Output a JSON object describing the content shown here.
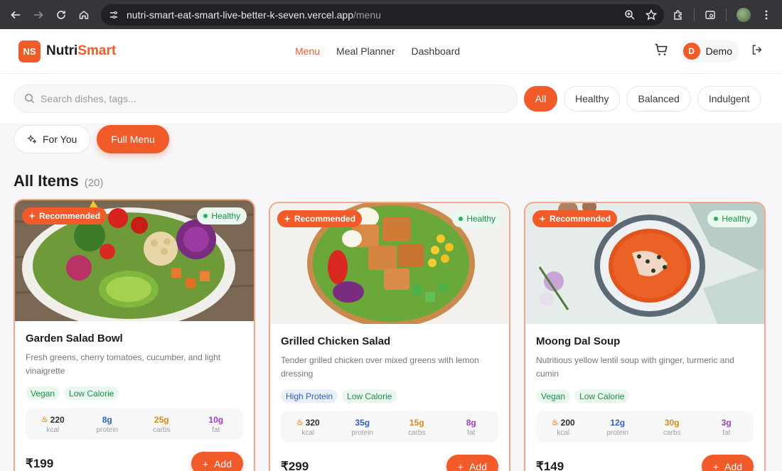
{
  "browser": {
    "url_host": "nutri-smart-eat-smart-live-better-k-seven.vercel.app",
    "url_path": "/menu"
  },
  "brand": {
    "badge": "NS",
    "name_part1": "Nutri",
    "name_part2": "Smart",
    "accent": "#f15a29"
  },
  "nav": {
    "items": [
      "Menu",
      "Meal Planner",
      "Dashboard"
    ],
    "active": "Menu"
  },
  "user": {
    "initial": "D",
    "name": "Demo"
  },
  "search": {
    "placeholder": "Search dishes, tags..."
  },
  "filters": [
    "All",
    "Healthy",
    "Balanced",
    "Indulgent"
  ],
  "modes": {
    "for_you": "For You",
    "full_menu": "Full Menu"
  },
  "section": {
    "title": "All Items",
    "count": "(20)"
  },
  "cards": [
    {
      "badge": "Recommended",
      "health": "Healthy",
      "name": "Garden Salad Bowl",
      "desc": "Fresh greens, cherry tomatoes, cucumber, and light vinaigrette",
      "tags": [
        "Vegan",
        "Low Calorie"
      ],
      "kcal": "220",
      "protein": "8g",
      "carbs": "25g",
      "fat": "10g",
      "price": "₹199",
      "add": "Add"
    },
    {
      "badge": "Recommended",
      "health": "Healthy",
      "name": "Grilled Chicken Salad",
      "desc": "Tender grilled chicken over mixed greens with lemon dressing",
      "tags": [
        "High Protein",
        "Low Calorie"
      ],
      "kcal": "320",
      "protein": "35g",
      "carbs": "15g",
      "fat": "8g",
      "price": "₹299",
      "add": "Add"
    },
    {
      "badge": "Recommended",
      "health": "Healthy",
      "name": "Moong Dal Soup",
      "desc": "Nutritious yellow lentil soup with ginger, turmeric and cumin",
      "tags": [
        "Vegan",
        "Low Calorie"
      ],
      "kcal": "200",
      "protein": "12g",
      "carbs": "30g",
      "fat": "3g",
      "price": "₹149",
      "add": "Add"
    }
  ],
  "labels": {
    "kcal": "kcal",
    "protein": "protein",
    "carbs": "carbs",
    "fat": "fat"
  }
}
